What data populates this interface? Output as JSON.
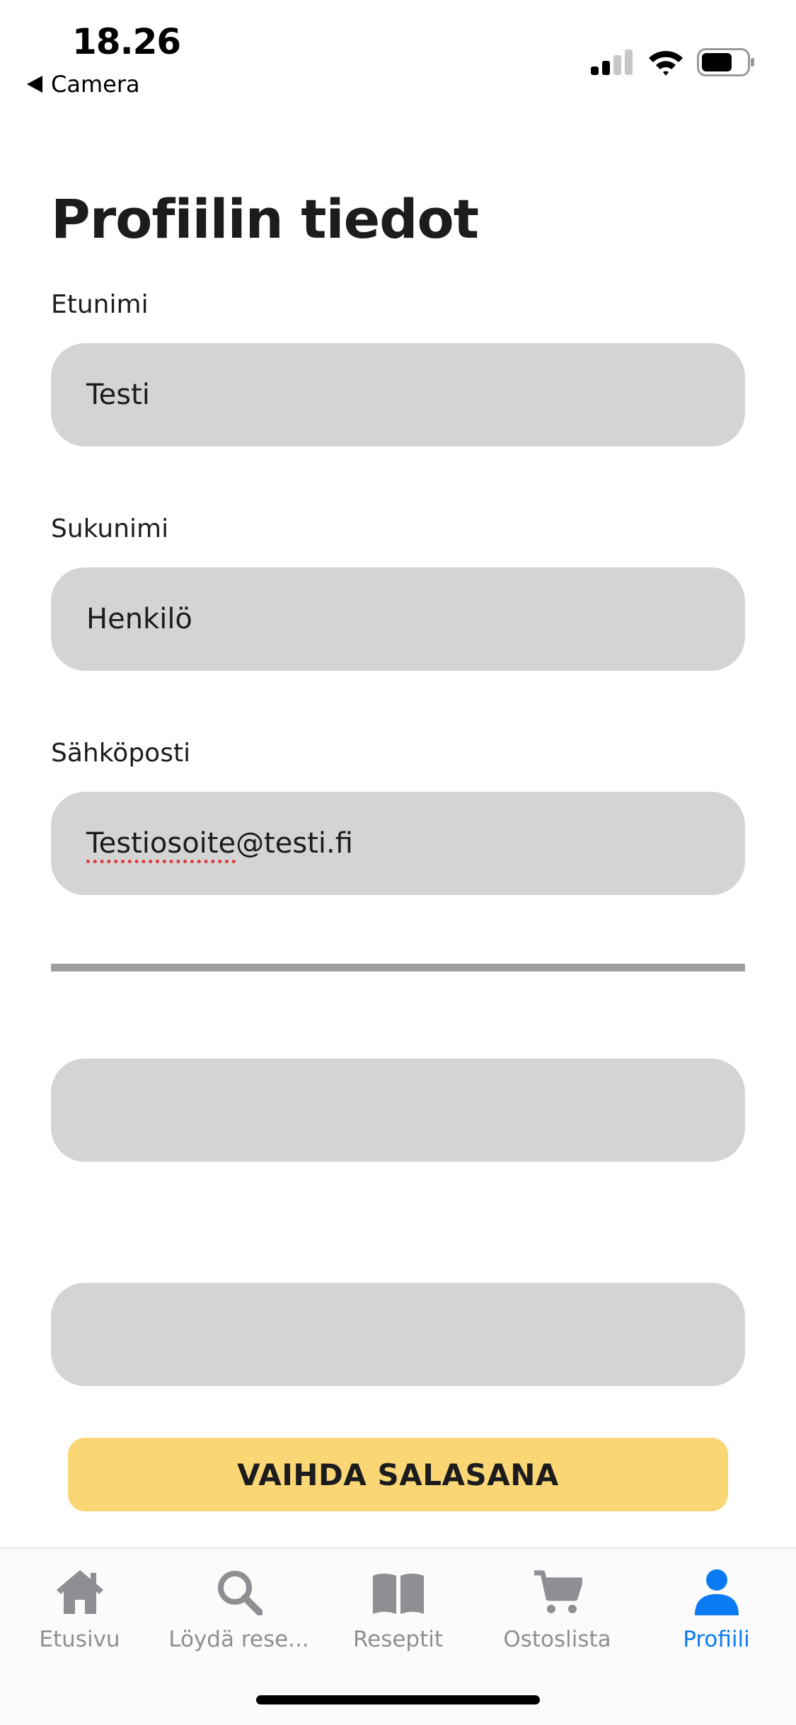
{
  "status_bar": {
    "time": "18.26",
    "back_label": "Camera"
  },
  "page": {
    "title": "Profiilin tiedot"
  },
  "form": {
    "first_name": {
      "label": "Etunimi",
      "value": "Testi"
    },
    "last_name": {
      "label": "Sukunimi",
      "value": "Henkilö"
    },
    "email": {
      "label": "Sähköposti",
      "value_misspelled": "Testiosoite",
      "value_rest": "@testi.fi"
    },
    "password_new": {
      "value": ""
    },
    "password_confirm": {
      "value": ""
    },
    "change_password_button": "VAIHDA SALASANA"
  },
  "tabbar": {
    "items": [
      {
        "label": "Etusivu",
        "icon": "home-icon",
        "active": false
      },
      {
        "label": "Löydä rese...",
        "icon": "search-icon",
        "active": false
      },
      {
        "label": "Reseptit",
        "icon": "book-icon",
        "active": false
      },
      {
        "label": "Ostoslista",
        "icon": "cart-icon",
        "active": false
      },
      {
        "label": "Profiili",
        "icon": "person-icon",
        "active": true
      }
    ]
  },
  "colors": {
    "accent": "#0a7bf3",
    "button": "#fad774",
    "field": "#d4d4d4",
    "inactive_tab": "#8e8e93"
  }
}
